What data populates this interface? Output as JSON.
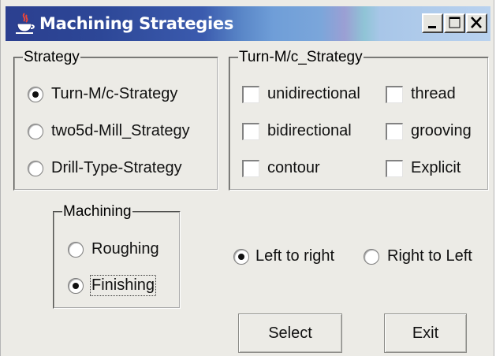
{
  "window": {
    "title": "Machining Strategies",
    "icon": "java-cup-icon",
    "controls": {
      "minimize": "minimize-icon",
      "maximize": "maximize-icon",
      "close": "close-icon"
    }
  },
  "strategy_group": {
    "legend": "Strategy",
    "options": [
      {
        "label": "Turn-M/c-Strategy",
        "checked": true
      },
      {
        "label": "two5d-Mill_Strategy",
        "checked": false
      },
      {
        "label": "Drill-Type-Strategy",
        "checked": false
      }
    ]
  },
  "turn_strategy_group": {
    "legend": "Turn-M/c_Strategy",
    "checkboxes": [
      {
        "label": "unidirectional",
        "checked": false
      },
      {
        "label": "thread",
        "checked": false
      },
      {
        "label": "bidirectional",
        "checked": false
      },
      {
        "label": "grooving",
        "checked": false
      },
      {
        "label": "contour",
        "checked": false
      },
      {
        "label": "Explicit",
        "checked": false
      }
    ]
  },
  "machining_group": {
    "legend": "Machining",
    "options": [
      {
        "label": "Roughing",
        "checked": false
      },
      {
        "label": "Finishing",
        "checked": true
      }
    ]
  },
  "direction": {
    "options": [
      {
        "label": "Left to right",
        "checked": true
      },
      {
        "label": "Right to Left",
        "checked": false
      }
    ]
  },
  "buttons": {
    "select": "Select",
    "exit": "Exit"
  }
}
